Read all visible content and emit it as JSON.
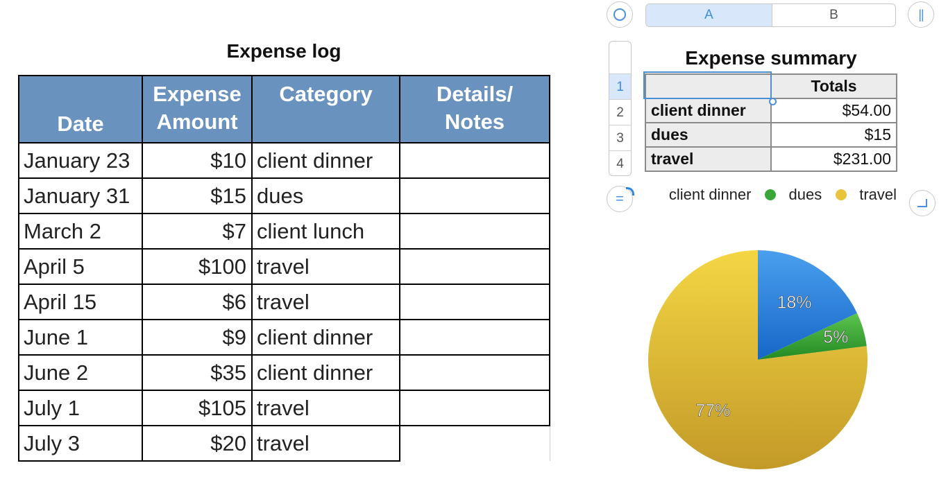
{
  "expense_log": {
    "title": "Expense log",
    "headers": {
      "date": "Date",
      "amount_line1": "Expense",
      "amount_line2": "Amount",
      "category": "Category",
      "notes_line1": "Details/",
      "notes_line2": "Notes"
    },
    "rows": [
      {
        "date": "January 23",
        "amount": "$10",
        "category": "client dinner",
        "notes": ""
      },
      {
        "date": "January 31",
        "amount": "$15",
        "category": "dues",
        "notes": ""
      },
      {
        "date": "March 2",
        "amount": "$7",
        "category": "client lunch",
        "notes": ""
      },
      {
        "date": "April 5",
        "amount": "$100",
        "category": "travel",
        "notes": ""
      },
      {
        "date": "April 15",
        "amount": "$6",
        "category": "travel",
        "notes": ""
      },
      {
        "date": "June 1",
        "amount": "$9",
        "category": "client dinner",
        "notes": ""
      },
      {
        "date": "June 2",
        "amount": "$35",
        "category": "client dinner",
        "notes": ""
      },
      {
        "date": "July 1",
        "amount": "$105",
        "category": "travel",
        "notes": ""
      },
      {
        "date": "July 3",
        "amount": "$20",
        "category": "travel",
        "notes": ""
      }
    ]
  },
  "column_headers": {
    "a": "A",
    "b": "B"
  },
  "row_headers": [
    "1",
    "2",
    "3",
    "4"
  ],
  "summary": {
    "title": "Expense summary",
    "header": {
      "label": "",
      "totals": "Totals"
    },
    "rows": [
      {
        "label": "client dinner",
        "total": "$54.00"
      },
      {
        "label": "dues",
        "total": "$15"
      },
      {
        "label": "travel",
        "total": "$231.00"
      }
    ]
  },
  "legend": [
    {
      "label": "client dinner",
      "color": "#2f86e0"
    },
    {
      "label": "dues",
      "color": "#3aa63a"
    },
    {
      "label": "travel",
      "color": "#e8c43a"
    }
  ],
  "chart_data": {
    "type": "pie",
    "categories": [
      "client dinner",
      "dues",
      "travel"
    ],
    "values": [
      54,
      15,
      231
    ],
    "labels": [
      "18%",
      "5%",
      "77%"
    ],
    "colors": [
      "#2f86e0",
      "#3aa63a",
      "#e0bd35"
    ],
    "legend_position": "top"
  }
}
